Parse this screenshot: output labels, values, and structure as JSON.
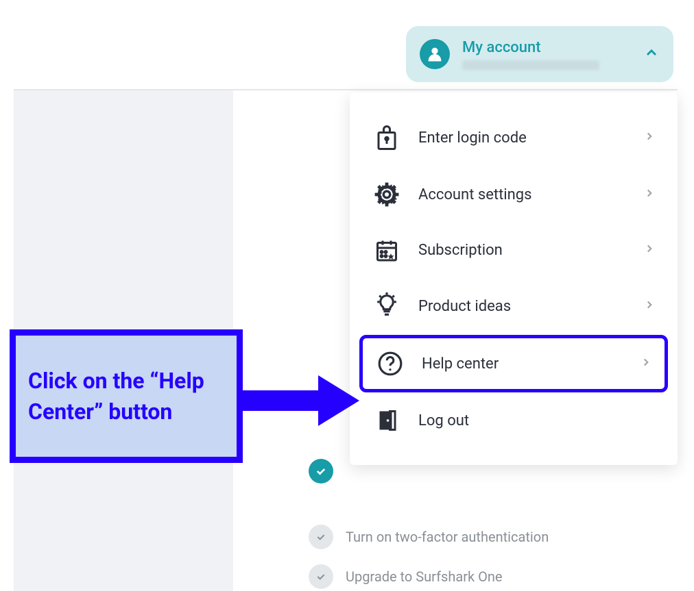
{
  "account": {
    "title": "My account"
  },
  "menu": {
    "items": [
      {
        "label": "Enter login code"
      },
      {
        "label": "Account settings"
      },
      {
        "label": "Subscription"
      },
      {
        "label": "Product ideas"
      },
      {
        "label": "Help center"
      },
      {
        "label": "Log out"
      }
    ]
  },
  "callout": {
    "text": "Click on the “Help Center” button"
  },
  "checklist": {
    "twofactor": "Turn on two-factor authentication",
    "upgrade": "Upgrade to Surfshark One"
  }
}
